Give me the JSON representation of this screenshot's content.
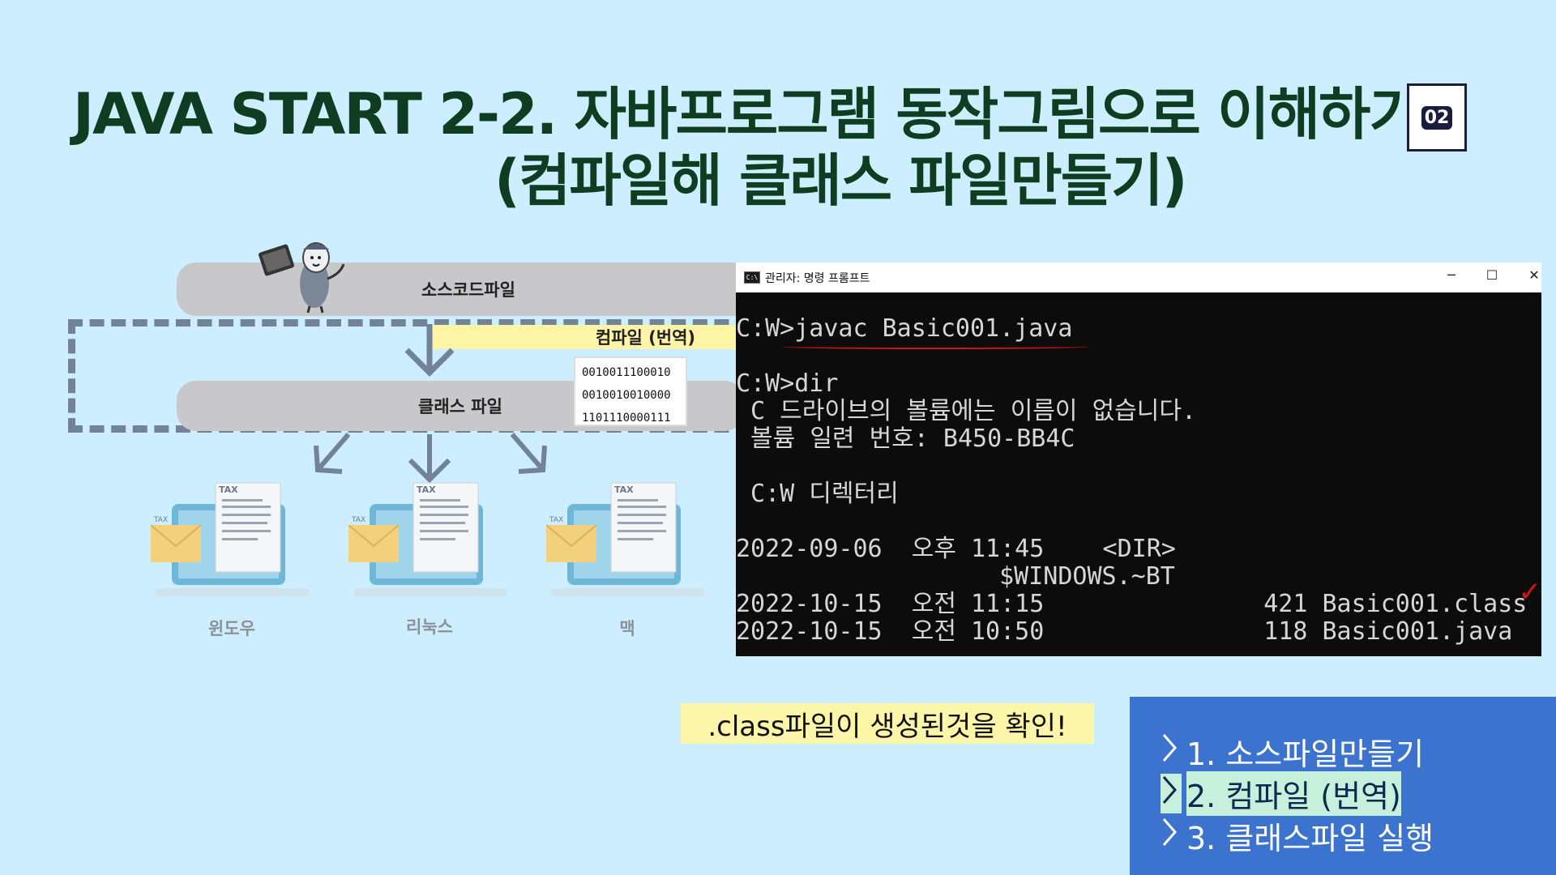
{
  "title": {
    "line1": "JAVA START 2-2. 자바프로그램 동작그림으로 이해하기",
    "line2": "(컴파일해 클래스 파일만들기)"
  },
  "page_number": "02",
  "diagram": {
    "source_bar": "소스코드파일",
    "compile_label": "컴파일 (번역)",
    "binary_lines": [
      "0010011100010",
      "0010010010000",
      "1101110000111"
    ],
    "class_bar": "클래스 파일",
    "targets": [
      {
        "label": "윈도우",
        "tax": "TAX"
      },
      {
        "label": "리눅스",
        "tax": "TAX"
      },
      {
        "label": "맥",
        "tax": "TAX"
      }
    ]
  },
  "terminal": {
    "window_title": "관리자: 명령 프롬프트",
    "lines": [
      "C:W>javac Basic001.java",
      "",
      "C:W>dir",
      " C 드라이브의 볼륨에는 이름이 없습니다.",
      " 볼륨 일련 번호: B450-BB4C",
      "",
      " C:W 디렉터리",
      "",
      "2022-09-06  오후 11:45    <DIR>",
      "                  $WINDOWS.~BT",
      "2022-10-15  오전 11:15               421 Basic001.class",
      "2022-10-15  오전 10:50               118 Basic001.java"
    ]
  },
  "note": ".class파일이 생성된것을 확인!",
  "toc": [
    {
      "label": "1. 소스파일만들기",
      "active": false
    },
    {
      "label": "2. 컴파일 (번역)",
      "active": true
    },
    {
      "label": "3.  클래스파일 실행",
      "active": false
    }
  ],
  "colors": {
    "background": "#cdeefe",
    "title": "#0e3d22",
    "toc_bg": "#3b73cf",
    "highlight": "#fdf6a9",
    "dashed": "#718299"
  }
}
